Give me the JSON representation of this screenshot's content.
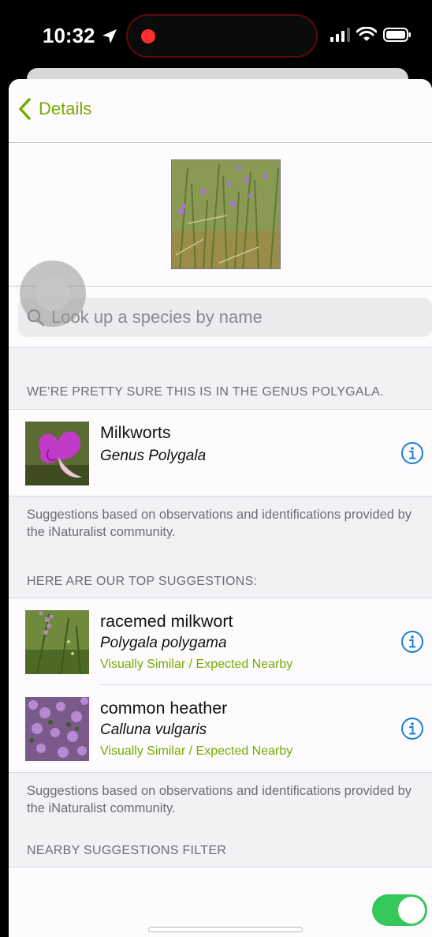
{
  "status_bar": {
    "time": "10:32"
  },
  "nav": {
    "back_label": "Details"
  },
  "search": {
    "placeholder": "Look up a species by name"
  },
  "sections": {
    "top_match_header": "WE'RE PRETTY SURE THIS IS IN THE GENUS POLYGALA.",
    "top_match_footer": "Suggestions based on observations and identifications provided by the iNaturalist community.",
    "suggestions_header": "HERE ARE OUR TOP SUGGESTIONS:",
    "suggestions_footer": "Suggestions based on observations and identifications provided by the iNaturalist community.",
    "filter_header": "NEARBY SUGGESTIONS FILTER"
  },
  "top_match": {
    "name": "Milkworts",
    "scientific": "Genus Polygala"
  },
  "suggestions": [
    {
      "name": "racemed milkwort",
      "scientific": "Polygala polygama",
      "tag": "Visually Similar / Expected Nearby"
    },
    {
      "name": "common heather",
      "scientific": "Calluna vulgaris",
      "tag": "Visually Similar / Expected Nearby"
    }
  ],
  "filter": {
    "label": "",
    "enabled": true
  },
  "colors": {
    "accent": "#74ac00",
    "info_blue": "#1a7fd4",
    "toggle_on": "#34c759",
    "recording": "#ff2d2d"
  }
}
